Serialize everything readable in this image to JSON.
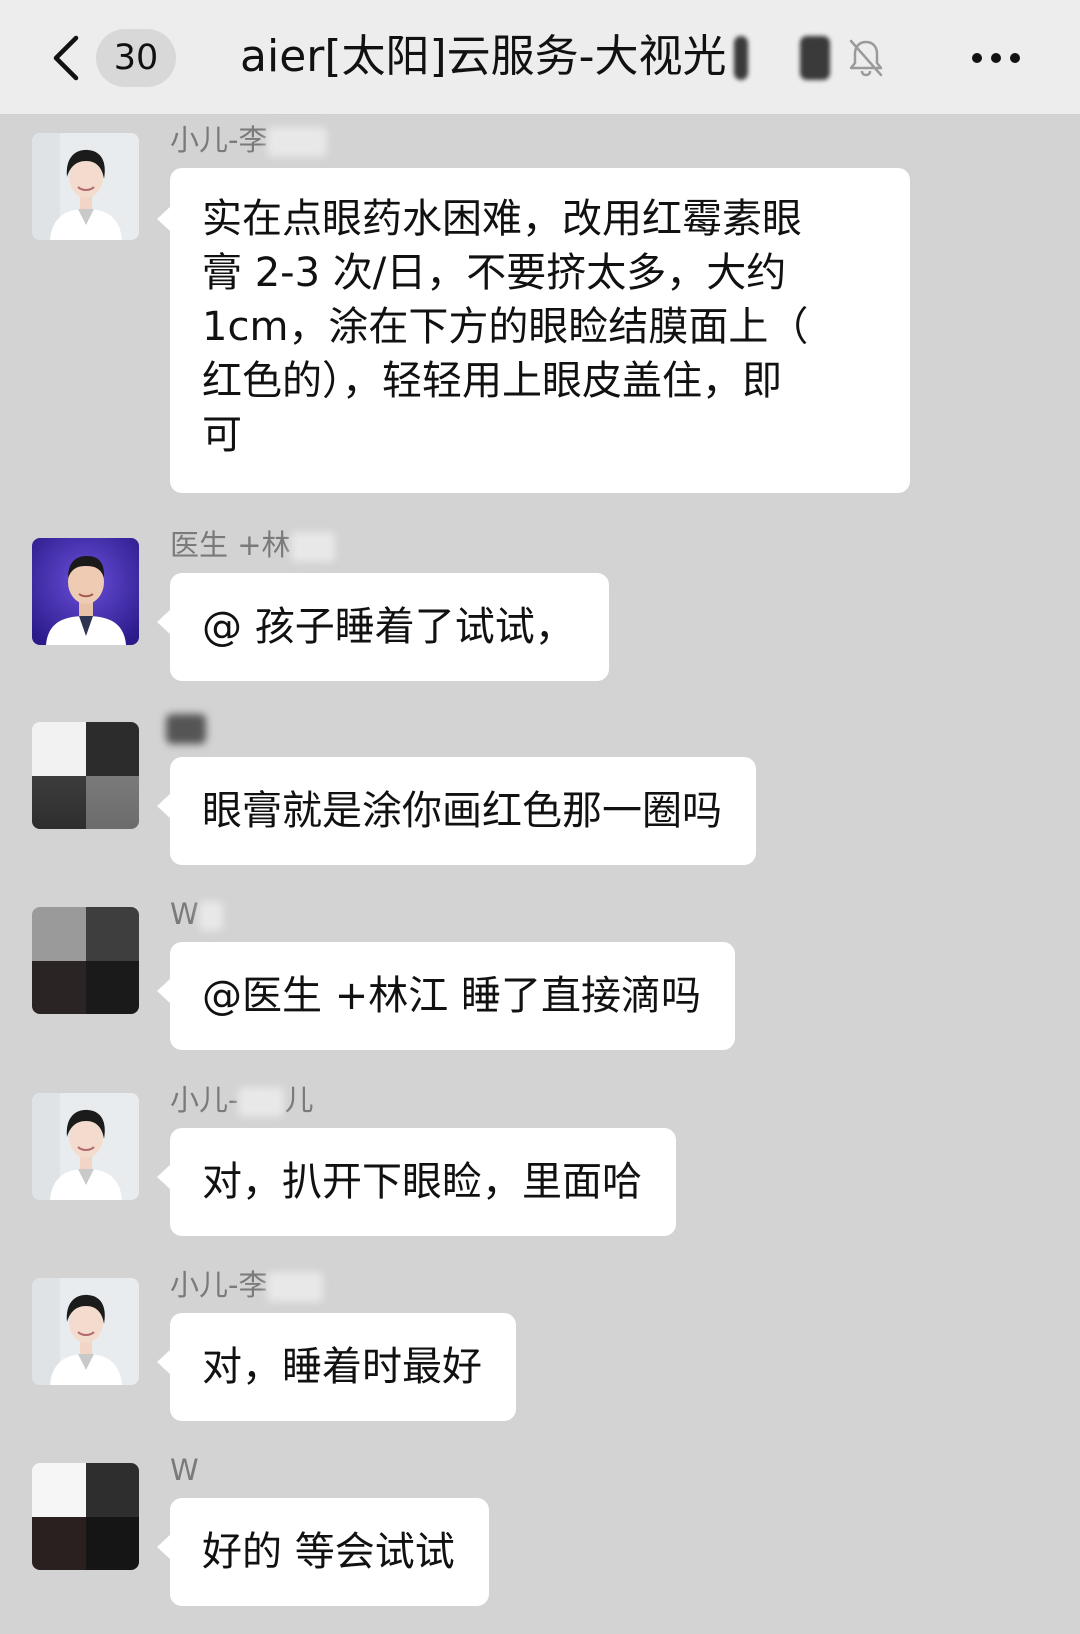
{
  "header": {
    "unread_count": "30",
    "title": "aier[太阳]云服务-大视光"
  },
  "messages": [
    {
      "sender": "小儿-李",
      "text_lines": [
        "实在点眼药水困难，改用红霉素眼",
        "膏 2-3 次/日，不要挤太多，大约",
        "1cm，涂在下方的眼睑结膜面上（",
        "红色的），轻轻用上眼皮盖住，即",
        "可"
      ]
    },
    {
      "sender": "医生 +林",
      "text": "@  孩子睡着了试试，"
    },
    {
      "sender": "",
      "text": "眼膏就是涂你画红色那一圈吗"
    },
    {
      "sender": "W",
      "text": "@医生 +林江  睡了直接滴吗"
    },
    {
      "sender": "小儿-",
      "sender_tail": "儿",
      "text": "对，扒开下眼睑，里面哈"
    },
    {
      "sender": "小儿-李",
      "text": "对，睡着时最好"
    },
    {
      "sender": "W",
      "text": "好的 等会试试"
    }
  ]
}
